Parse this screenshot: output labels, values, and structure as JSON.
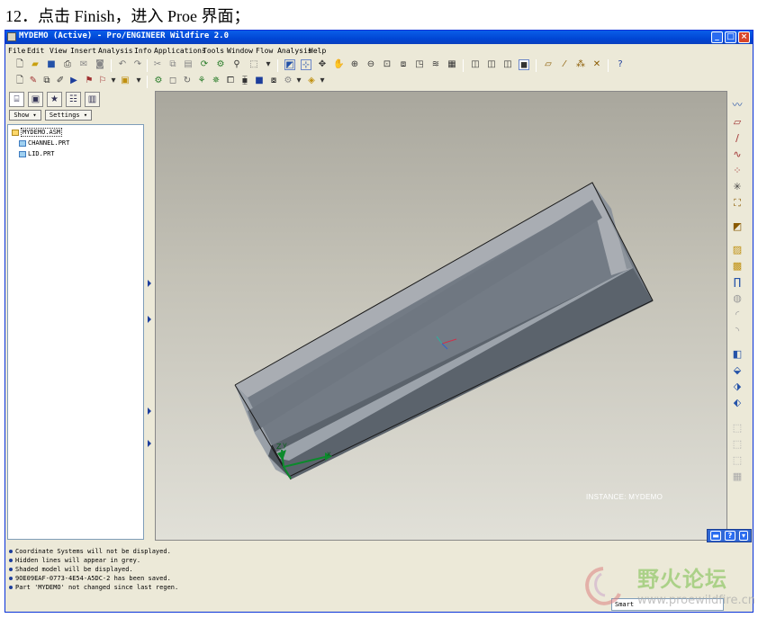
{
  "caption": "12．点击 Finish，进入 Proe 界面；",
  "window": {
    "title": "MYDEMO (Active) - Pro/ENGINEER Wildfire 2.0",
    "buttons": {
      "minimize": "_",
      "maximize": "□",
      "close": "×"
    }
  },
  "menu": [
    "File",
    "Edit",
    "View",
    "Insert",
    "Analysis",
    "Info",
    "Applications",
    "Tools",
    "Window",
    "Flow Analysis",
    "Help"
  ],
  "toolbar_row1_icons": [
    "new-icon",
    "open-icon",
    "save-icon",
    "print-icon",
    "cut-icon",
    "copy-icon",
    "undo-icon",
    "redo-icon",
    "paste-icon",
    "regenerate-icon",
    "find-icon",
    "zoom-in-icon",
    "zoom-out-icon",
    "refit-icon",
    "datum-plane-icon",
    "datum-axis-icon",
    "datum-point-icon",
    "csys-icon",
    "help-icon"
  ],
  "toolbar_row2_icons": [
    "sketch-icon",
    "edit-icon",
    "play-icon",
    "annotate-icon",
    "flag-icon",
    "analysis-icon"
  ],
  "nav": {
    "show_label": "Show",
    "settings_label": "Settings",
    "tree": [
      {
        "label": "MYDEMO.ASM"
      },
      {
        "label": "CHANNEL.PRT"
      },
      {
        "label": "LID.PRT"
      }
    ]
  },
  "viewport": {
    "instance_label": "INSTANCE: MYDEMO",
    "csys_labels": {
      "z": "Z",
      "y": "y",
      "x": "x"
    }
  },
  "messages": [
    "Coordinate Systems will not be displayed.",
    "Hidden lines will appear in grey.",
    "Shaded model will be displayed.",
    "9OE09EAF-0773-4E54-A5DC-2 has been saved.",
    "Part 'MYDEMO' not changed since last regen."
  ],
  "status": {
    "smart_filter": "Smart"
  },
  "watermark": {
    "title": "野火论坛",
    "url": "www.proewildfire.cn"
  },
  "colors": {
    "titlebar": "#0046d5",
    "model_top": "#a9adb3",
    "model_side": "#5b636c",
    "model_inner": "#737b85"
  }
}
